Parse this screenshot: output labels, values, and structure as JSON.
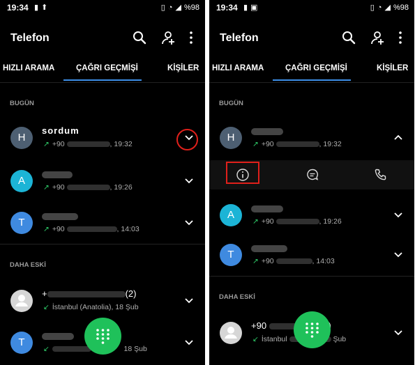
{
  "status": {
    "time": "19:34",
    "battery": "%98"
  },
  "app": {
    "title": "Telefon"
  },
  "tabs": {
    "speed_dial": "HIZLI ARAMA",
    "call_history": "ÇAĞRI GEÇMİŞİ",
    "contacts": "KİŞİLER"
  },
  "sections": {
    "today": "BUGÜN",
    "older": "DAHA ESKİ"
  },
  "left": {
    "calls": [
      {
        "initial": "H",
        "name": "sordum",
        "prefix": "+90",
        "time": ", 19:32"
      },
      {
        "initial": "A",
        "prefix": "+90",
        "time": ", 19:26"
      },
      {
        "initial": "T",
        "prefix": "+90",
        "time": ", 14:03"
      }
    ],
    "older": [
      {
        "name_prefix": "+",
        "count": "(2)",
        "location": "İstanbul (Anatolia), 18 Şub"
      },
      {
        "initial": "T",
        "date": "18 Şub"
      }
    ]
  },
  "right": {
    "calls": [
      {
        "initial": "H",
        "prefix": "+90",
        "time": ", 19:32"
      },
      {
        "initial": "A",
        "prefix": "+90",
        "time": ", 19:26"
      },
      {
        "initial": "T",
        "prefix": "+90",
        "time": ", 14:03"
      }
    ],
    "older": [
      {
        "name_prefix": "+90",
        "name_suffix": "5",
        "count": "(2)",
        "location_prefix": "İstanbul",
        "date": "Şub"
      }
    ]
  },
  "icons": {
    "search": "search-icon",
    "add_user": "add-user-icon",
    "more": "more-vert-icon",
    "info": "info-icon",
    "message": "message-icon",
    "call": "phone-icon",
    "dialpad": "dialpad-icon",
    "chevron_down": "chevron-down-icon",
    "chevron_up": "chevron-up-icon"
  },
  "colors": {
    "accent": "#3d8fe8",
    "fab": "#1fc15a",
    "highlight": "#e0201b",
    "call_arrow": "#2fcf6a"
  }
}
